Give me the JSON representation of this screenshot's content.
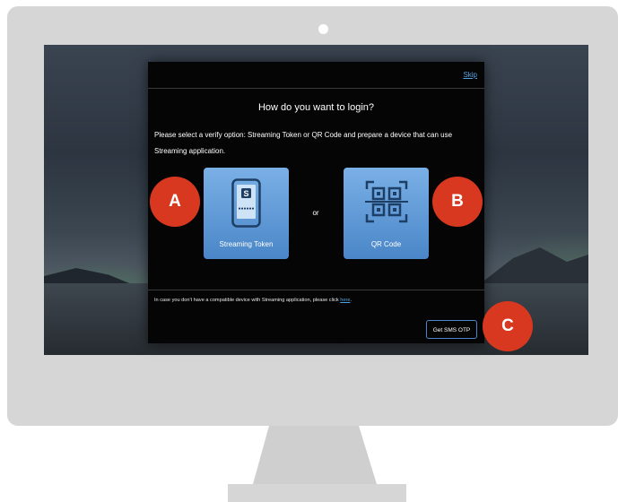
{
  "dialog": {
    "skip_label": "Skip",
    "title": "How do you want to login?",
    "instruction": "Please select a verify option: Streaming Token or QR Code and prepare a device that can use Streaming application.",
    "options": [
      {
        "label": "Streaming Token",
        "icon": "smartphone-token-icon"
      },
      {
        "label": "QR Code",
        "icon": "qr-code-icon"
      }
    ],
    "separator": "or",
    "footer": {
      "text": "In case you don't have a compatible device with Streaming application, please click ",
      "link": "here",
      "suffix": "."
    },
    "sms_button_label": "Get SMS OTP"
  },
  "markers": {
    "a": "A",
    "b": "B",
    "c": "C"
  },
  "colors": {
    "option_blue": "#4a86c8",
    "marker_red": "#d8381f",
    "link_blue": "#4fa3e0",
    "dialog_bg": "#050505",
    "monitor_gray": "#d6d6d6"
  }
}
